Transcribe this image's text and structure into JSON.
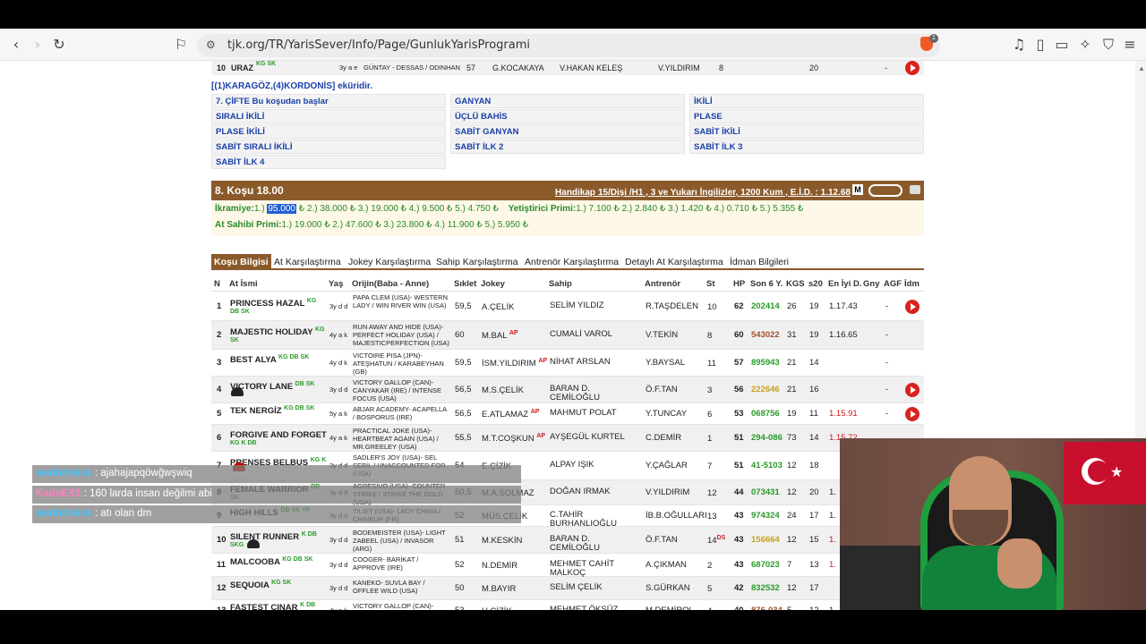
{
  "browser": {
    "url": "tjk.org/TR/YarisSever/Info/Page/GunlukYarisProgrami",
    "shield_badge": "1"
  },
  "prev_row": {
    "no": "10",
    "name": "URAZ",
    "tags": "KG SK",
    "age": "3y a e",
    "origin": "GÜNTAY - DESSAS / ODINHAN",
    "weight": "57",
    "jockey": "G.KOCAKAYA",
    "owner": "V.HAKAN KELEŞ",
    "trainer": "V.YILDIRIM",
    "st": "8",
    "s20": "20",
    "best": "-"
  },
  "ekuri": "[(1)KARAGÖZ,(4)KORDONİS] eküridir.",
  "bets": [
    "7. ÇİFTE Bu koşudan başlar",
    "GANYAN",
    "İKİLİ",
    "SIRALI İKİLİ",
    "ÜÇLÜ BAHİS",
    "PLASE",
    "PLASE İKİLİ",
    "SABİT GANYAN",
    "SABİT İKİLİ",
    "SABİT SIRALI İKİLİ",
    "SABİT İLK 2",
    "SABİT İLK 3",
    "SABİT İLK 4"
  ],
  "race": {
    "title": "8. Koşu 18.00",
    "info": "Handikap 15/Dişi /H1 , 3 ve Yukarı İngilizler, 1200 Kum , E.İ.D. : 1.12.68",
    "m_label": "M",
    "prize_label": "İkramiye:",
    "prize_1_pre": "1.) ",
    "prize_1": "95.000",
    "prize_rest": " ₺  2.) 38.000 ₺  3.) 19.000 ₺  4.) 9.500 ₺  5.) 4.750 ₺",
    "breeder_label": "Yetiştirici Primi:",
    "breeder": "1.) 7.100 ₺  2.) 2.840 ₺  3.) 1.420 ₺  4.) 0.710 ₺  5.) 5.355 ₺",
    "owner_label": "At Sahibi Primi:",
    "owner": "1.) 19.000 ₺  2.) 47.600 ₺  3.) 23.800 ₺  4.) 11.900 ₺  5.) 5.950 ₺"
  },
  "tabs": [
    "Koşu Bilgisi",
    "At Karşılaştırma",
    "Jokey Karşılaştırma",
    "Sahip Karşılaştırma",
    "Antrenör Karşılaştırma",
    "Detaylı At Karşılaştırma",
    "İdman Bilgileri"
  ],
  "columns": [
    "N",
    "At İsmi",
    "Yaş",
    "Orijin(Baba - Anne)",
    "Sıklet",
    "Jokey",
    "Sahip",
    "Antrenör",
    "St",
    "HP",
    "Son 6 Y.",
    "KGS",
    "s20",
    "En İyi D.",
    "Gny",
    "AGF",
    "İdm"
  ],
  "rows": [
    {
      "n": "1",
      "name": "PRINCESS HAZAL",
      "tags": "KG",
      "tags2": "DB SK",
      "age": "3y d d",
      "origin": "PAPA CLEM (USA)- WESTERN LADY / WIN RIVER WIN (USA)",
      "weight": "59,5",
      "jockey": "A.ÇELİK",
      "ap": "",
      "owner": "SELİM YILDIZ",
      "trainer": "R.TAŞDELEN",
      "st": "10",
      "hp": "62",
      "form": "202414",
      "form_color": "#2a9a2a",
      "kgs": "26",
      "s20": "19",
      "best": "1.17.43",
      "best_red": false,
      "gny": "",
      "agf": "-",
      "play": true
    },
    {
      "n": "2",
      "name": "MAJESTIC HOLIDAY",
      "tags": "KG",
      "tags2": "SK",
      "age": "4y a k",
      "origin": "RUN AWAY AND HIDE (USA)- PERFECT HOLIDAY (USA) / MAJESTICPERFECTION (USA)",
      "weight": "60",
      "jockey": "M.BAL",
      "ap": "AP",
      "owner": "CUMALİ VAROL",
      "trainer": "V.TEKİN",
      "st": "8",
      "hp": "60",
      "form": "543022",
      "form_color": "#a0522d",
      "kgs": "31",
      "s20": "19",
      "best": "1.16.65",
      "best_red": false,
      "gny": "",
      "agf": "-",
      "play": false
    },
    {
      "n": "3",
      "name": "BEST ALYA",
      "tags": "KG DB SK",
      "tags2": "",
      "age": "4y d k",
      "origin": "VICTOIRE PISA (JPN)- ATEŞHATUN / KARABEYHAN (GB)",
      "weight": "59,5",
      "jockey": "İSM.YILDIRIM",
      "ap": "AP",
      "owner": "NİHAT ARSLAN",
      "trainer": "Y.BAYSAL",
      "st": "11",
      "hp": "57",
      "form": "895943",
      "form_color": "#2a9a2a",
      "kgs": "21",
      "s20": "14",
      "best": "",
      "best_red": false,
      "gny": "",
      "agf": "-",
      "play": false
    },
    {
      "n": "4",
      "name": "VICTORY LANE",
      "tags": "DB SK",
      "tags2": "",
      "age": "3y d d",
      "origin": "VICTORY GALLOP (CAN)- CANYAKAR (IRE) / INTENSE FOCUS (USA)",
      "weight": "56,5",
      "jockey": "M.S.ÇELİK",
      "ap": "",
      "owner": "BARAN D. CEMİLOĞLU",
      "trainer": "Ö.F.TAN",
      "st": "3",
      "hp": "56",
      "form": "222646",
      "form_color": "#c8a020",
      "kgs": "21",
      "s20": "16",
      "best": "",
      "best_red": false,
      "gny": "",
      "agf": "-",
      "play": true
    },
    {
      "n": "5",
      "name": "TEK NERGİZ",
      "tags": "KG DB SK",
      "tags2": "",
      "age": "5y a k",
      "origin": "ABJAR ACADEMY- ACAPELLA / BOSPORUS (IRE)",
      "weight": "56,5",
      "jockey": "E.ATLAMAZ",
      "ap": "AP",
      "owner": "MAHMUT POLAT",
      "trainer": "Y.TUNCAY",
      "st": "6",
      "hp": "53",
      "form": "068756",
      "form_color": "#2a9a2a",
      "kgs": "19",
      "s20": "11",
      "best": "1.15.91",
      "best_red": true,
      "gny": "",
      "agf": "-",
      "play": true
    },
    {
      "n": "6",
      "name": "FORGIVE AND FORGET",
      "tags": "",
      "tags2": "KG K DB",
      "age": "4y a k",
      "origin": "PRACTICAL JOKE (USA)- HEARTBEAT AGAIN (USA) / MR.GREELEY (USA)",
      "weight": "55,5",
      "jockey": "M.T.COŞKUN",
      "ap": "AP",
      "owner": "AYŞEGÜL KURTEL",
      "trainer": "C.DEMİR",
      "st": "1",
      "hp": "51",
      "form": "294-086",
      "form_color": "#2a9a2a",
      "kgs": "73",
      "s20": "14",
      "best": "1.15.72",
      "best_red": true,
      "gny": "",
      "agf": "",
      "play": false
    },
    {
      "n": "7",
      "name": "PRENSES BELBUS",
      "tags": "KG K",
      "tags2": "",
      "age": "3y d d",
      "origin": "SADLER'S JOY (USA)- SEL SEBİL / UNACCOUNTED FOR (USA)",
      "weight": "54",
      "jockey": "E.ÇİZİK",
      "ap": "",
      "owner": "ALPAY IŞIK",
      "trainer": "Y.ÇAĞLAR",
      "st": "7",
      "hp": "51",
      "form": "41-5103",
      "form_color": "#2a9a2a",
      "kgs": "12",
      "s20": "18",
      "best": "",
      "best_red": false,
      "gny": "",
      "agf": "",
      "play": false
    },
    {
      "n": "8",
      "name": "FEMALE WARRIOR",
      "tags": "DB",
      "tags2": "SK",
      "age": "3y d d",
      "origin": "AGRESIVO (USA)- COUNTER STRIKE / STRIKE THE GOLD (USA)",
      "weight": "50,5",
      "jockey": "M.A.SOLMAZ",
      "ap": "",
      "owner": "DOĞAN IRMAK",
      "trainer": "V.YILDIRIM",
      "st": "12",
      "hp": "44",
      "form": "073431",
      "form_color": "#2a9a2a",
      "kgs": "12",
      "s20": "20",
      "best": "1.",
      "best_red": false,
      "gny": "",
      "agf": "",
      "play": false
    },
    {
      "n": "9",
      "name": "HIGH HILLS",
      "tags": "DB SK YP",
      "tags2": "",
      "age": "3y d d",
      "origin": "TILSIT (USA)- LADY CHINA / CHINEUR (FR)",
      "weight": "52",
      "jockey": "MÜS.ÇELİK",
      "ap": "",
      "owner": "C.TAHİR BURHANLIOĞLU",
      "trainer": "İB.B.OĞULLARI",
      "st": "13",
      "hp": "43",
      "form": "974324",
      "form_color": "#2a9a2a",
      "kgs": "24",
      "s20": "17",
      "best": "1.",
      "best_red": false,
      "gny": "",
      "agf": "",
      "play": false
    },
    {
      "n": "10",
      "name": "SILENT RUNNER",
      "tags": "K DB",
      "tags2": "SKG",
      "age": "3y d d",
      "origin": "BODEMEISTER (USA)- LIGHT ZABEEL (USA) / INVASOR (ARG)",
      "weight": "51",
      "jockey": "M.KESKİN",
      "ap": "",
      "owner": "BARAN D. CEMİLOĞLU",
      "trainer": "Ö.F.TAN",
      "st": "14",
      "st_sup": "DS",
      "hp": "43",
      "form": "156664",
      "form_color": "#c8a020",
      "kgs": "12",
      "s20": "15",
      "best": "1.",
      "best_red": true,
      "gny": "",
      "agf": "",
      "play": false
    },
    {
      "n": "11",
      "name": "MALCOOBA",
      "tags": "KG DB SK",
      "tags2": "",
      "age": "3y d d",
      "origin": "COOGER- BARİKAT / APPROVE (IRE)",
      "weight": "52",
      "jockey": "N.DEMİR",
      "ap": "",
      "owner": "MEHMET CAHİT MALKOÇ",
      "trainer": "A.ÇIKMAN",
      "st": "2",
      "hp": "43",
      "form": "687023",
      "form_color": "#2a9a2a",
      "kgs": "7",
      "s20": "13",
      "best": "1.",
      "best_red": true,
      "gny": "",
      "agf": "",
      "play": false
    },
    {
      "n": "12",
      "name": "SEQUOIA",
      "tags": "KG SK",
      "tags2": "",
      "age": "3y d d",
      "origin": "KANEKO- SUVLA BAY / OFFLEE WILD (USA)",
      "weight": "50",
      "jockey": "M.BAYIR",
      "ap": "",
      "owner": "SELİM ÇELİK",
      "trainer": "S.GÜRKAN",
      "st": "5",
      "hp": "42",
      "form": "832532",
      "form_color": "#2a9a2a",
      "kgs": "12",
      "s20": "17",
      "best": "",
      "best_red": false,
      "gny": "",
      "agf": "",
      "play": false
    },
    {
      "n": "13",
      "name": "FASTEST ÇINAR",
      "tags": "K DB",
      "tags2": "",
      "age": "4y a k",
      "origin": "VICTORY GALLOP (CAN)- MAGNOLIA / OCEAN CREST (USA)",
      "weight": "53",
      "jockey": "H.ÇİZİK",
      "ap": "",
      "owner": "MEHMET ÖKSÜZ",
      "trainer": "M.DEMİROL",
      "st": "4",
      "hp": "40",
      "form": "876-034",
      "form_color": "#a0522d",
      "kgs": "5",
      "s20": "12",
      "best": "1.",
      "best_red": false,
      "gny": "",
      "agf": "",
      "play": false
    }
  ],
  "chat": [
    {
      "user": "sevketreiss",
      "user_color": "#40c4ff",
      "text": ": ajahajapqöwğwşwiq"
    },
    {
      "user": "KadoEX1",
      "user_color": "#ff80c0",
      "text": ": 160 larda insan değilmi abi"
    },
    {
      "user": "sevketreiss",
      "user_color": "#40c4ff",
      "text": ": atı olan dm"
    }
  ],
  "colors": {
    "accent_brown": "#8b5a2b",
    "link_blue": "#1a3fa8",
    "play_red": "#d9231d"
  }
}
